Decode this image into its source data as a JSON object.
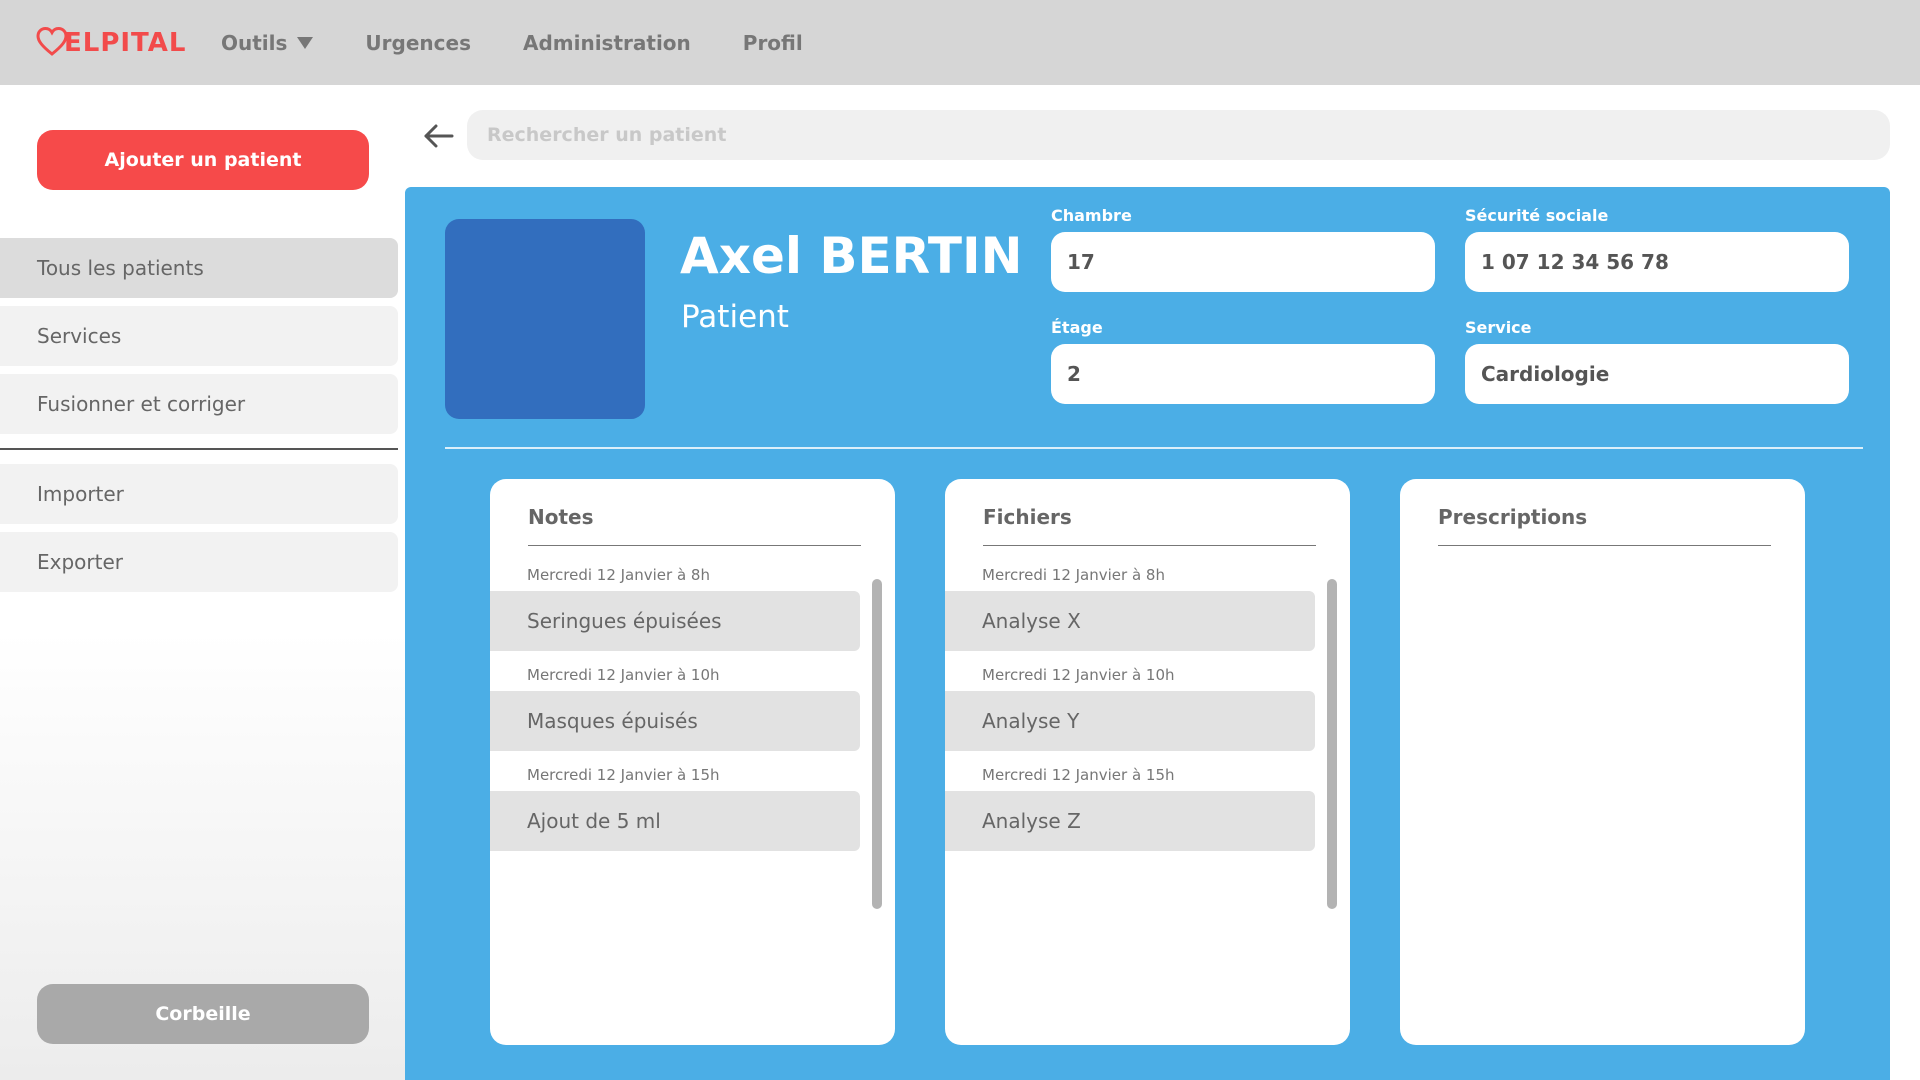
{
  "app": {
    "logo_text": "ELPITAL",
    "brand_color": "#f24b4b",
    "logo_icon": "heart-icon"
  },
  "nav": {
    "items": [
      {
        "label": "Outils",
        "has_dropdown": true
      },
      {
        "label": "Urgences"
      },
      {
        "label": "Administration"
      },
      {
        "label": "Profil"
      }
    ]
  },
  "sidebar": {
    "add_patient_label": "Ajouter un patient",
    "items": [
      {
        "label": "Tous les patients",
        "active": true
      },
      {
        "label": "Services"
      },
      {
        "label": "Fusionner et corriger"
      },
      {
        "label": "Importer"
      },
      {
        "label": "Exporter"
      }
    ],
    "trash_label": "Corbeille"
  },
  "search": {
    "placeholder": "Rechercher un patient",
    "value": ""
  },
  "patient": {
    "name": "Axel BERTIN",
    "role": "Patient",
    "fields": {
      "chambre": {
        "label": "Chambre",
        "value": "17"
      },
      "securite_sociale": {
        "label": "Sécurité sociale",
        "value": "1 07 12 34 56 78"
      },
      "etage": {
        "label": "Étage",
        "value": "2"
      },
      "service": {
        "label": "Service",
        "value": "Cardiologie"
      }
    }
  },
  "cards": {
    "notes": {
      "title": "Notes",
      "entries": [
        {
          "date": "Mercredi 12 Janvier à 8h",
          "label": "Seringues épuisées"
        },
        {
          "date": "Mercredi 12 Janvier à 10h",
          "label": "Masques épuisés"
        },
        {
          "date": "Mercredi 12 Janvier à 15h",
          "label": "Ajout de 5 ml"
        }
      ]
    },
    "fichiers": {
      "title": "Fichiers",
      "entries": [
        {
          "date": "Mercredi 12 Janvier à 8h",
          "label": "Analyse X"
        },
        {
          "date": "Mercredi 12 Janvier à 10h",
          "label": "Analyse Y"
        },
        {
          "date": "Mercredi 12 Janvier à 15h",
          "label": "Analyse Z"
        }
      ]
    },
    "prescriptions": {
      "title": "Prescriptions",
      "entries": []
    }
  },
  "colors": {
    "panel": "#4baee6",
    "avatar": "#326ebe",
    "primary_button": "#f64a4a",
    "secondary_button": "#a9a9a9"
  }
}
